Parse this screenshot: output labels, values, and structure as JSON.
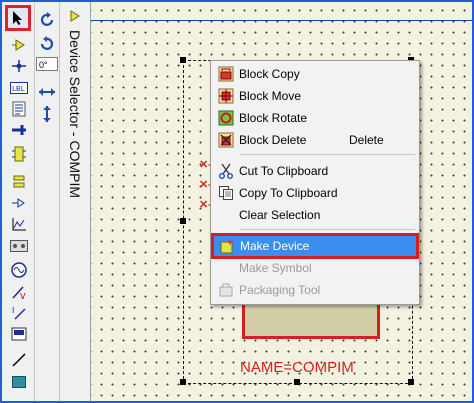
{
  "toolbar": {
    "tools": [
      {
        "name": "selection-mode-tool",
        "icon": "arrow-cursor-icon",
        "selected": true
      },
      {
        "name": "component-mode-tool",
        "icon": "component-arrow-icon"
      },
      {
        "name": "junction-dot-tool",
        "icon": "junction-dot-icon"
      },
      {
        "name": "wire-label-tool",
        "icon": "wire-label-icon"
      },
      {
        "name": "text-script-tool",
        "icon": "text-script-icon"
      },
      {
        "name": "buses-tool",
        "icon": "bus-icon"
      },
      {
        "name": "subcircuit-tool",
        "icon": "subcircuit-icon"
      },
      {
        "name": "terminals-tool",
        "icon": "terminal-icon"
      },
      {
        "name": "device-pins-tool",
        "icon": "device-pin-icon"
      },
      {
        "name": "graph-tool",
        "icon": "graph-icon"
      },
      {
        "name": "tape-recorder-tool",
        "icon": "tape-icon"
      },
      {
        "name": "generator-tool",
        "icon": "generator-icon"
      },
      {
        "name": "voltage-probe-tool",
        "icon": "voltage-probe-icon"
      },
      {
        "name": "current-probe-tool",
        "icon": "current-probe-icon"
      },
      {
        "name": "virtual-instruments-tool",
        "icon": "instrument-icon"
      },
      {
        "name": "line-tool",
        "icon": "line-icon"
      },
      {
        "name": "box-tool",
        "icon": "box-icon"
      }
    ]
  },
  "rotation": {
    "angle_value": "0°"
  },
  "device_selector": {
    "title": "Device Selector - COMPIM"
  },
  "canvas": {
    "device_label": "NAME=COMPIM"
  },
  "context_menu": {
    "items": [
      {
        "label": "Block Copy",
        "shortcut": "",
        "icon": "block-copy-icon",
        "enabled": true
      },
      {
        "label": "Block Move",
        "shortcut": "",
        "icon": "block-move-icon",
        "enabled": true
      },
      {
        "label": "Block Rotate",
        "shortcut": "",
        "icon": "block-rotate-icon",
        "enabled": true
      },
      {
        "label": "Block Delete",
        "shortcut": "Delete",
        "icon": "block-delete-icon",
        "enabled": true
      },
      {
        "label": "Cut To Clipboard",
        "shortcut": "",
        "icon": "scissors-icon",
        "enabled": true
      },
      {
        "label": "Copy To Clipboard",
        "shortcut": "",
        "icon": "copy-icon",
        "enabled": true
      },
      {
        "label": "Clear Selection",
        "shortcut": "",
        "icon": "",
        "enabled": true
      },
      {
        "label": "Make Device",
        "shortcut": "",
        "icon": "make-device-icon",
        "enabled": true,
        "highlighted": true
      },
      {
        "label": "Make Symbol",
        "shortcut": "",
        "icon": "",
        "enabled": false
      },
      {
        "label": "Packaging Tool",
        "shortcut": "",
        "icon": "packaging-tool-icon",
        "enabled": false
      }
    ]
  },
  "colors": {
    "highlight": "#3b8ef0",
    "annotation_red": "#d81e1e",
    "canvas_bg": "#f3f1df"
  }
}
